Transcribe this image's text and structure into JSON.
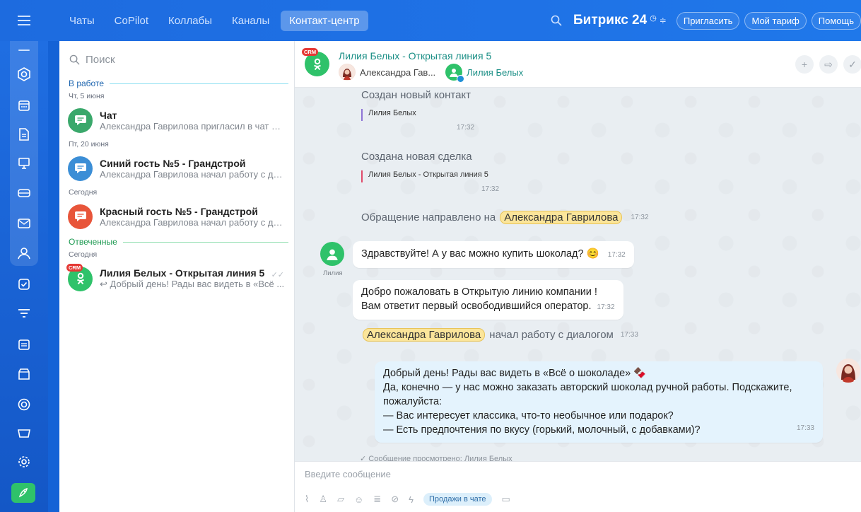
{
  "topbar": {
    "tabs": [
      {
        "label": "Чаты"
      },
      {
        "label": "CoPilot"
      },
      {
        "label": "Коллабы"
      },
      {
        "label": "Каналы"
      },
      {
        "label": "Контакт-центр"
      }
    ],
    "brand": "Битрикс 24",
    "buttons": [
      "Пригласить",
      "Мой тариф",
      "Помощь"
    ]
  },
  "search": {
    "placeholder": "Поиск"
  },
  "chat_list": {
    "section_in_work": "В работе",
    "section_answered": "Отвеченные",
    "dates": [
      "Чт, 5 июня",
      "Пт, 20 июня",
      "Сегодня",
      "Сегодня"
    ],
    "items": [
      {
        "title": "Чат",
        "subtitle": "Александра Гаврилова пригласил в чат Ел...",
        "color": "#3aa86b"
      },
      {
        "title": "Синий гость №5 - Грандстрой",
        "subtitle": "Александра Гаврилова начал работу с ди...",
        "color": "#3b8ed6"
      },
      {
        "title": "Красный гость №5 - Грандстрой",
        "subtitle": "Александра Гаврилова начал работу с ди...",
        "color": "#e8553a"
      },
      {
        "title": "Лилия Белых - Открытая линия 5",
        "subtitle": "↩ Добрый день! Рады вас видеть в «Всё ...",
        "badge": "CRM",
        "color": "#2fc26a"
      }
    ]
  },
  "chat": {
    "title": "Лилия Белых - Открытая линия 5",
    "badge": "CRM",
    "member1": "Александра Гав...",
    "member2": "Лилия Белых",
    "events": {
      "contact_title": "Создан новый контакт",
      "contact_name": "Лилия Белых",
      "contact_time": "17:32",
      "deal_title": "Создана новая сделка",
      "deal_name": "Лилия Белых - Открытая линия 5",
      "deal_time": "17:32",
      "routed_text": "Обращение направлено на",
      "routed_name": "Александра Гаврилова",
      "routed_time": "17:32",
      "started_name": "Александра Гаврилова",
      "started_text": "начал работу с диалогом",
      "started_time": "17:33"
    },
    "messages": [
      {
        "text": "Здравствуйте! А у вас можно купить шоколад? 😊",
        "time": "17:32",
        "sender": "Лилия"
      },
      {
        "line1": "Добро пожаловать в Открытую линию компании !",
        "line2": "Вам ответит первый освободившийся оператор.",
        "time": "17:32"
      },
      {
        "line1": "Добрый день! Рады вас видеть в «Всё о шоколаде» 🍫",
        "line2": "Да, конечно — у нас можно заказать авторский шоколад ручной работы. Подскажите,",
        "line3": "пожалуйста:",
        "line4": "— Вас интересует классика, что-то необычное или подарок?",
        "line5": "— Есть предпочтения по вкусу (горький, молочный, с добавками)?",
        "time": "17:33"
      }
    ],
    "viewed": "✓ Сообщение просмотрено: Лилия Белых"
  },
  "composer": {
    "placeholder": "Введите сообщение",
    "sales_button": "Продажи в чате"
  }
}
